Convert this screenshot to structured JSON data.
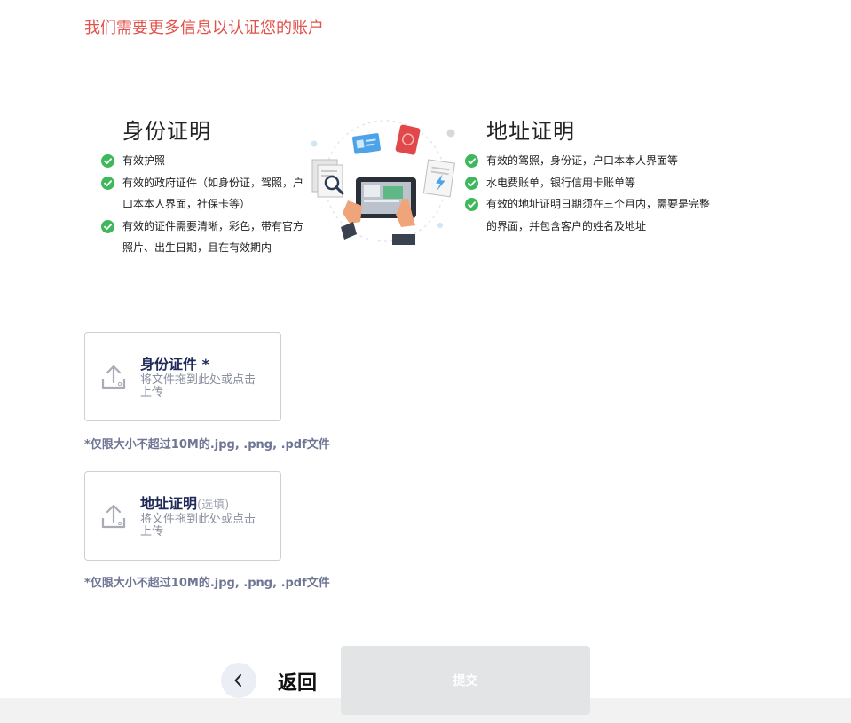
{
  "headline": "我们需要更多信息以认证您的账户",
  "identity_proof": {
    "title": "身份证明",
    "items": [
      "有效护照",
      "有效的政府证件（如身份证，驾照，户口本本人界面，社保卡等）",
      "有效的证件需要清晰，彩色，带有官方照片、出生日期，且在有效期内"
    ]
  },
  "address_proof": {
    "title": "地址证明",
    "items": [
      "有效的驾照，身份证，户口本本人界面等",
      "水电费账单，银行信用卡账单等",
      "有效的地址证明日期须在三个月内，需要是完整的界面，并包含客户的姓名及地址"
    ]
  },
  "uploads": [
    {
      "title": "身份证件 *",
      "optional": "",
      "hint": "将文件拖到此处或点击上传",
      "note": "*仅限大小不超过10M的.jpg, .png, .pdf文件"
    },
    {
      "title": "地址证明",
      "optional": "(选填)",
      "hint": "将文件拖到此处或点击上传",
      "note": "*仅限大小不超过10M的.jpg, .png, .pdf文件"
    }
  ],
  "actions": {
    "back_label": "返回",
    "submit_label": "提交"
  },
  "colors": {
    "headline": "#e0524a",
    "check": "#3fb85c",
    "upload_title": "#1f2a59",
    "submit_disabled": "#e3e4e5"
  },
  "icons": {
    "check": "check-circle-icon",
    "upload": "upload-icon",
    "back": "chevron-left-icon"
  }
}
